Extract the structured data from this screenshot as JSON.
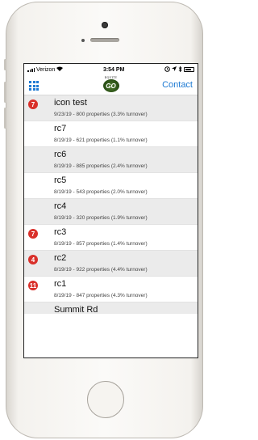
{
  "status_bar": {
    "carrier": "Verizon",
    "time": "3:54 PM"
  },
  "nav": {
    "logo_top": "EQUITY",
    "logo_main": "GO",
    "contact_label": "Contact"
  },
  "items": [
    {
      "badge": "7",
      "title": "icon test",
      "subtitle": "9/23/19 - 800 properties (3.3% turnover)",
      "shaded": true
    },
    {
      "badge": "",
      "title": "rc7",
      "subtitle": "8/19/19 - 621 properties (1.1% turnover)",
      "shaded": false
    },
    {
      "badge": "",
      "title": "rc6",
      "subtitle": "8/19/19 - 885 properties (2.4% turnover)",
      "shaded": true
    },
    {
      "badge": "",
      "title": "rc5",
      "subtitle": "8/19/19 - 543 properties (2.0% turnover)",
      "shaded": false
    },
    {
      "badge": "",
      "title": "rc4",
      "subtitle": "8/19/19 - 320 properties (1.9% turnover)",
      "shaded": true
    },
    {
      "badge": "7",
      "title": "rc3",
      "subtitle": "8/19/19 - 857 properties (1.4% turnover)",
      "shaded": false
    },
    {
      "badge": "4",
      "title": "rc2",
      "subtitle": "8/19/19 - 922 properties (4.4% turnover)",
      "shaded": true
    },
    {
      "badge": "11",
      "title": "rc1",
      "subtitle": "8/19/19 - 847 properties (4.3% turnover)",
      "shaded": false
    }
  ],
  "partial_item_title": "Summit Rd",
  "colors": {
    "accent": "#1e7ad3",
    "badge": "#d9302a",
    "row_shaded": "#ebebeb"
  },
  "icons": [
    "wifi-icon",
    "grid-menu-icon",
    "location-arrow-icon",
    "alarm-icon",
    "battery-icon"
  ]
}
